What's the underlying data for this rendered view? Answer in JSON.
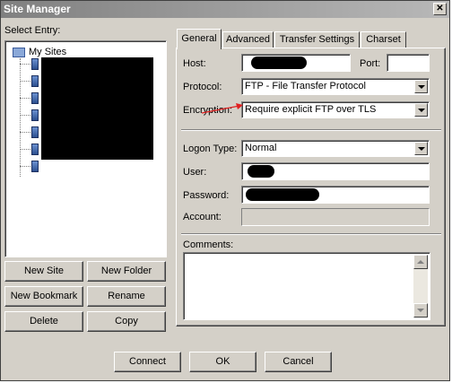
{
  "window": {
    "title": "Site Manager"
  },
  "tree": {
    "label": "Select Entry:",
    "root": "My Sites",
    "item_count": 7
  },
  "left_buttons": {
    "new_site": "New Site",
    "new_folder": "New Folder",
    "new_bookmark": "New Bookmark",
    "rename": "Rename",
    "delete": "Delete",
    "copy": "Copy"
  },
  "tabs": [
    "General",
    "Advanced",
    "Transfer Settings",
    "Charset"
  ],
  "general": {
    "host_label": "Host:",
    "port_label": "Port:",
    "port_value": "",
    "protocol_label": "Protocol:",
    "protocol_value": "FTP - File Transfer Protocol",
    "encryption_label": "Encryption:",
    "encryption_value": "Require explicit FTP over TLS",
    "logon_label": "Logon Type:",
    "logon_value": "Normal",
    "user_label": "User:",
    "password_label": "Password:",
    "account_label": "Account:",
    "comments_label": "Comments:"
  },
  "footer": {
    "connect": "Connect",
    "ok": "OK",
    "cancel": "Cancel"
  },
  "colors": {
    "annotation_arrow": "#e02020",
    "redaction": "#000000"
  }
}
